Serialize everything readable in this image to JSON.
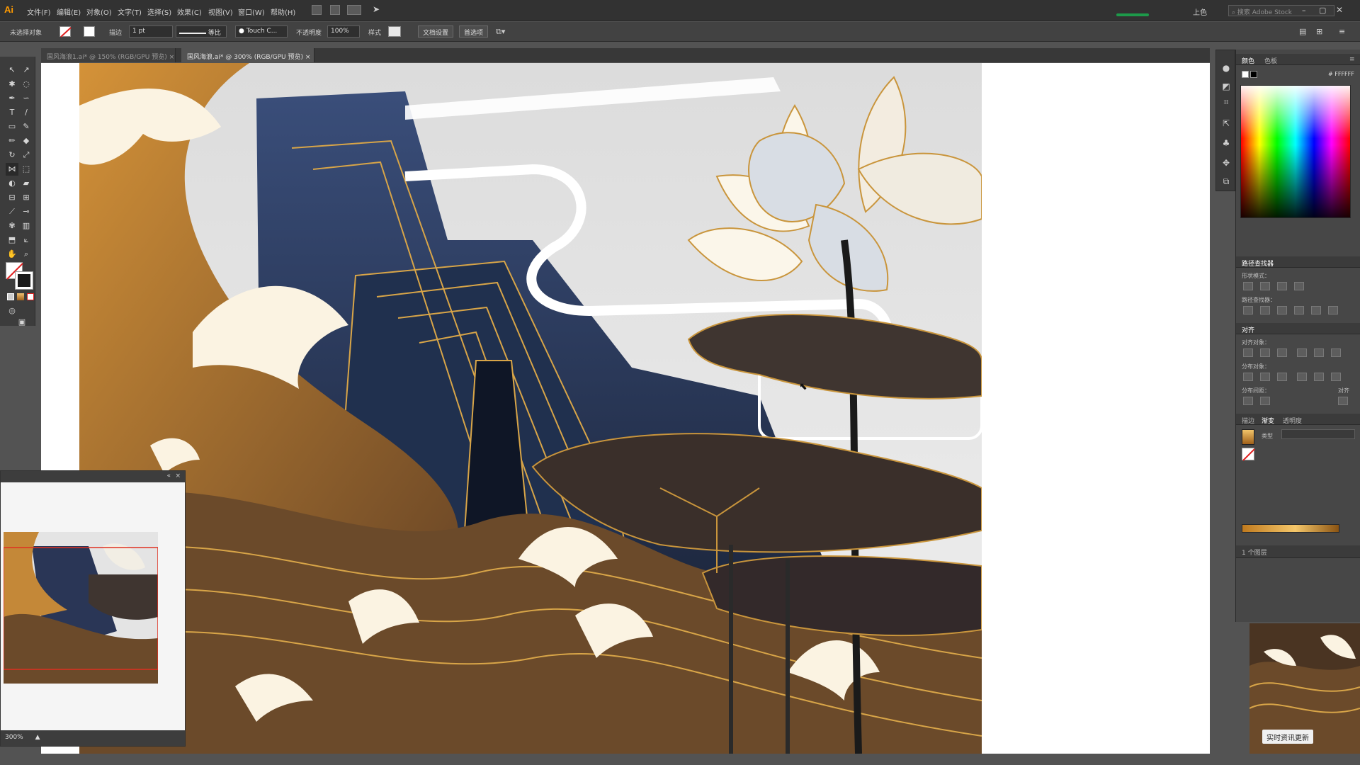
{
  "app": {
    "logo": "Ai"
  },
  "menu": [
    "文件(F)",
    "编辑(E)",
    "对象(O)",
    "文字(T)",
    "选择(S)",
    "效果(C)",
    "视图(V)",
    "窗口(W)",
    "帮助(H)"
  ],
  "window": {
    "workspace": "上色",
    "search_placeholder": "搜索 Adobe Stock"
  },
  "control_bar": {
    "selection_label": "未选择对象",
    "stroke_label": "描边",
    "stroke_value": "1 pt",
    "stroke_style": "等比",
    "brush": "Touch C...",
    "opacity_label": "不透明度",
    "opacity_value": "100%",
    "style_label": "样式",
    "doc_setup_button": "文档设置",
    "preferences_button": "首选项"
  },
  "tabs": [
    {
      "label": "国风海浪1.ai* @ 150% (RGB/GPU 预览)",
      "active": false
    },
    {
      "label": "国风海浪.ai* @ 300% (RGB/GPU 预览)",
      "active": true
    }
  ],
  "navigator": {
    "zoom": "300%"
  },
  "panels": {
    "color": {
      "tabs": [
        "颜色",
        "色板"
      ],
      "hex": "FFFFFF"
    },
    "pathfinder": {
      "title": "路径查找器",
      "shape_modes": "形状模式：",
      "pathfinders": "路径查找器："
    },
    "align": {
      "title": "对齐",
      "align_objects": "对齐对象：",
      "distribute_objects": "分布对象：",
      "distribute_spacing": "分布间距：",
      "align_to": "对齐"
    },
    "gradient": {
      "tabs": [
        "描边",
        "渐变",
        "透明度"
      ],
      "type_label": "类型"
    },
    "layers": {
      "count": "1 个图层"
    }
  },
  "watermark": "实时资讯更新",
  "colors": {
    "accent_gold": "#d39a3c",
    "mountain_navy": "#2a3656",
    "wave_brown": "#6b4a2a"
  }
}
